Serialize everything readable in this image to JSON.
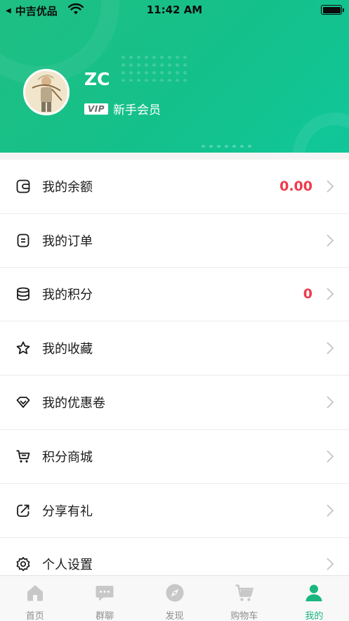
{
  "status_bar": {
    "carrier": "中吉优品",
    "time": "11:42 AM"
  },
  "profile": {
    "name": "ZC",
    "vip_badge": "VIP",
    "level": "新手会员"
  },
  "menu": [
    {
      "label": "我的余额",
      "value": "0.00",
      "icon": "wallet-icon"
    },
    {
      "label": "我的订单",
      "value": "",
      "icon": "order-icon"
    },
    {
      "label": "我的积分",
      "value": "0",
      "icon": "coins-icon"
    },
    {
      "label": "我的收藏",
      "value": "",
      "icon": "star-icon"
    },
    {
      "label": "我的优惠卷",
      "value": "",
      "icon": "diamond-icon"
    },
    {
      "label": "积分商城",
      "value": "",
      "icon": "cart-icon"
    },
    {
      "label": "分享有礼",
      "value": "",
      "icon": "share-icon"
    },
    {
      "label": "个人设置",
      "value": "",
      "icon": "gear-icon"
    }
  ],
  "tabbar": [
    {
      "label": "首页",
      "icon": "home-icon",
      "active": false
    },
    {
      "label": "群聊",
      "icon": "chat-icon",
      "active": false
    },
    {
      "label": "发现",
      "icon": "compass-icon",
      "active": false
    },
    {
      "label": "购物车",
      "icon": "cart-icon",
      "active": false
    },
    {
      "label": "我的",
      "icon": "user-icon",
      "active": true
    }
  ],
  "colors": {
    "brand_green": "#19b77f",
    "value_red": "#ee3b4b"
  }
}
